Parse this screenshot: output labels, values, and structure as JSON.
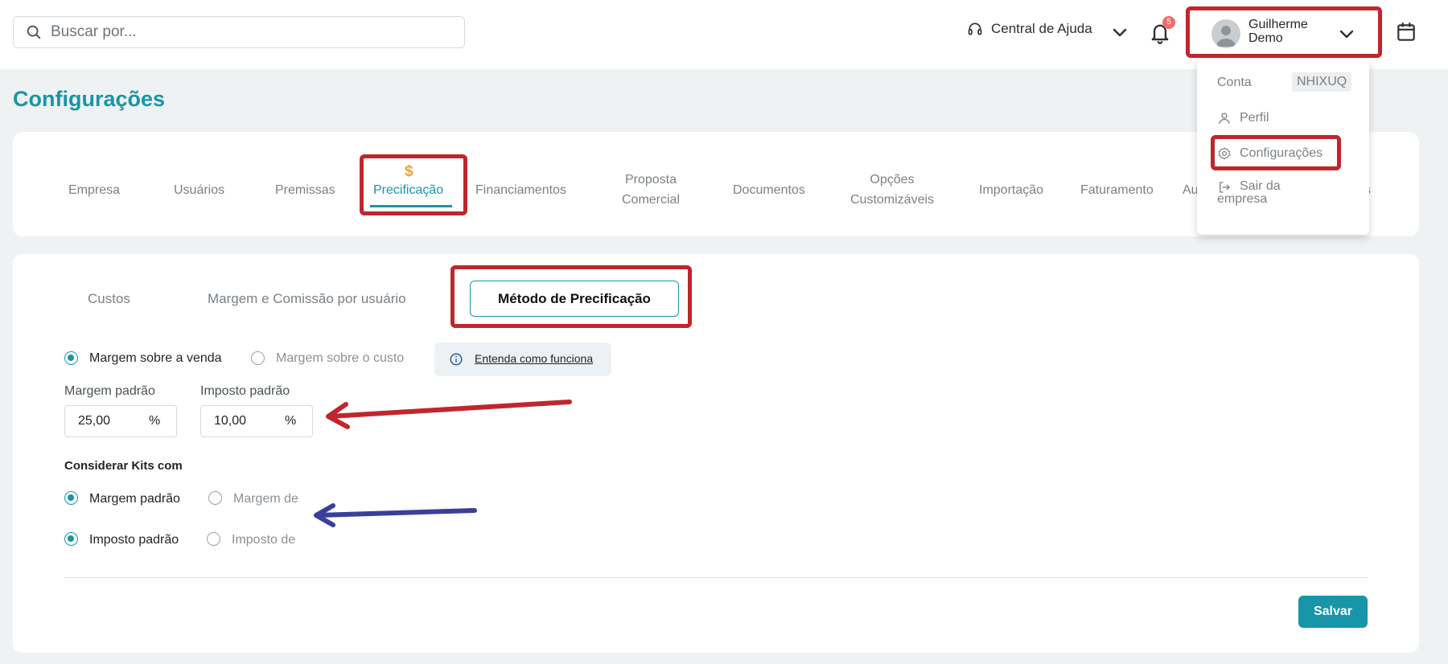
{
  "search": {
    "placeholder": "Buscar por..."
  },
  "header": {
    "help_label": "Central de Ajuda",
    "notification_count": "5",
    "user_name_line1": "Guilherme",
    "user_name_line2": "Demo"
  },
  "user_menu": {
    "account_label": "Conta",
    "account_code": "NHIXUQ",
    "profile": "Perfil",
    "settings": "Configurações",
    "exit_line1": "Sair da",
    "exit_line2": "empresa"
  },
  "page_title": "Configurações",
  "tabs": {
    "empresa": "Empresa",
    "usuarios": "Usuários",
    "premissas": "Premissas",
    "precificacao": "Precificação",
    "financiamentos": "Financiamentos",
    "proposta_1": "Proposta",
    "proposta_2": "Comercial",
    "documentos": "Documentos",
    "opcoes_1": "Opções",
    "opcoes_2": "Customizáveis",
    "importacao": "Importação",
    "faturamento": "Faturamento",
    "partial_left": "Au",
    "partial_right": "s"
  },
  "subtabs": {
    "custos": "Custos",
    "margem_comissao": "Margem e Comissão por usuário",
    "metodo": "Método de Precificação"
  },
  "pricing": {
    "opt_venda": "Margem sobre a venda",
    "opt_custo": "Margem sobre o custo",
    "info_link": "Entenda como funciona",
    "margem_label": "Margem padrão",
    "margem_value": "25,00",
    "imposto_label": "Imposto padrão",
    "imposto_value": "10,00",
    "percent": "%"
  },
  "kits": {
    "title": "Considerar Kits com",
    "margem_padrao": "Margem padrão",
    "margem_de": "Margem de",
    "imposto_padrao": "Imposto padrão",
    "imposto_de": "Imposto de"
  },
  "save_label": "Salvar",
  "colors": {
    "accent": "#1895a8",
    "highlight": "#c0262c",
    "arrow_red": "#c0262c",
    "arrow_blue": "#3b3f9a",
    "badge": "#f06d6d"
  }
}
